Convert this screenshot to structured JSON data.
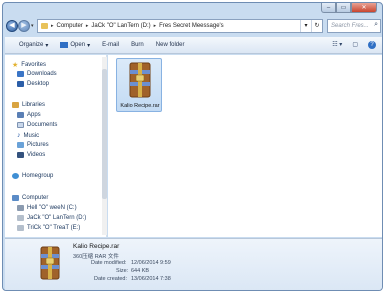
{
  "window": {
    "controls": [
      "–",
      "▭",
      "✕"
    ]
  },
  "address": {
    "crumbs": [
      "Computer",
      "JaCk \"O\" LanTern (D:)",
      "Fres Secret Meessage's"
    ]
  },
  "search": {
    "placeholder": "Search Fres..."
  },
  "toolbar": {
    "organize": "Organize",
    "open": "Open",
    "email": "E-mail",
    "burn": "Burn",
    "new_folder": "New folder",
    "help": "?"
  },
  "nav": {
    "favorites": "Favorites",
    "downloads": "Downloads",
    "desktop": "Desktop",
    "libraries": "Libraries",
    "apps": "Apps",
    "documents": "Documents",
    "music": "Music",
    "pictures": "Pictures",
    "videos": "Videos",
    "homegroup": "Homegroup",
    "computer": "Computer",
    "drive_c": "Hell \"O\" weeN (C:)",
    "drive_d": "JaCk \"O\" LanTern (D:)",
    "drive_e": "TriCk \"O\" TreaT (E:)"
  },
  "file": {
    "name": "Kalio Recipe.rar"
  },
  "details": {
    "name": "Kalio Recipe.rar",
    "type": "360压缩 RAR 文件",
    "modified_label": "Date modified:",
    "modified": "12/06/2014 9:59",
    "size_label": "Size:",
    "size": "644 KB",
    "created_label": "Date created:",
    "created": "13/06/2014 7:38"
  },
  "colors": {
    "accent": "#2f6fc4",
    "frame": "#c9dcf0",
    "winrar_brown": "#a0622a"
  }
}
